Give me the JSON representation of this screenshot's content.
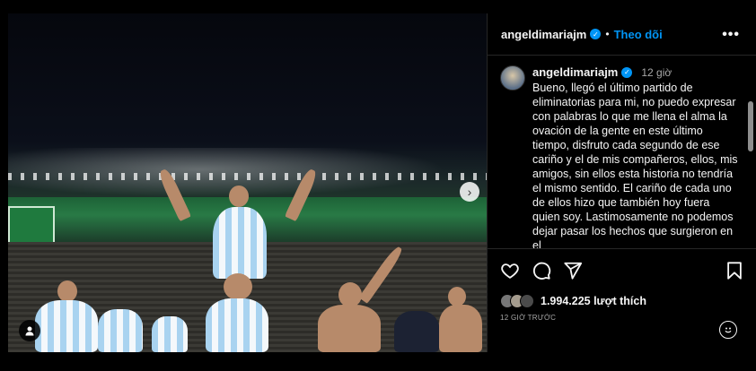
{
  "post": {
    "username": "angeldimariajm",
    "follow_label": "Theo dõi",
    "separator": "•",
    "more_label": "•••",
    "time_ago": "12 giờ",
    "caption": "Bueno, llegó el último partido de eliminatorias para mi, no puedo expresar con palabras lo que me llena el alma la ovación de la gente en este último tiempo, disfruto cada segundo de ese cariño y el de mis compañeros, ellos, mis amigos, sin ellos esta historia no tendría el mismo sentido. El cariño de cada uno de ellos hizo que también hoy fuera quien soy. Lastimosamente no podemos dejar pasar los hechos que surgieron en el",
    "likes": "1.994.225 lượt thích",
    "posted_ago": "12 GIỜ TRƯỚC",
    "next_icon": "›"
  },
  "colors": {
    "accent": "#0095f6",
    "background": "#000000",
    "muted": "#a8a8a8",
    "divider": "#262626"
  },
  "icons": [
    "verified-icon",
    "more-icon",
    "heart-icon",
    "comment-icon",
    "share-icon",
    "bookmark-icon",
    "emoji-icon",
    "next-arrow-icon",
    "user-tag-icon"
  ]
}
